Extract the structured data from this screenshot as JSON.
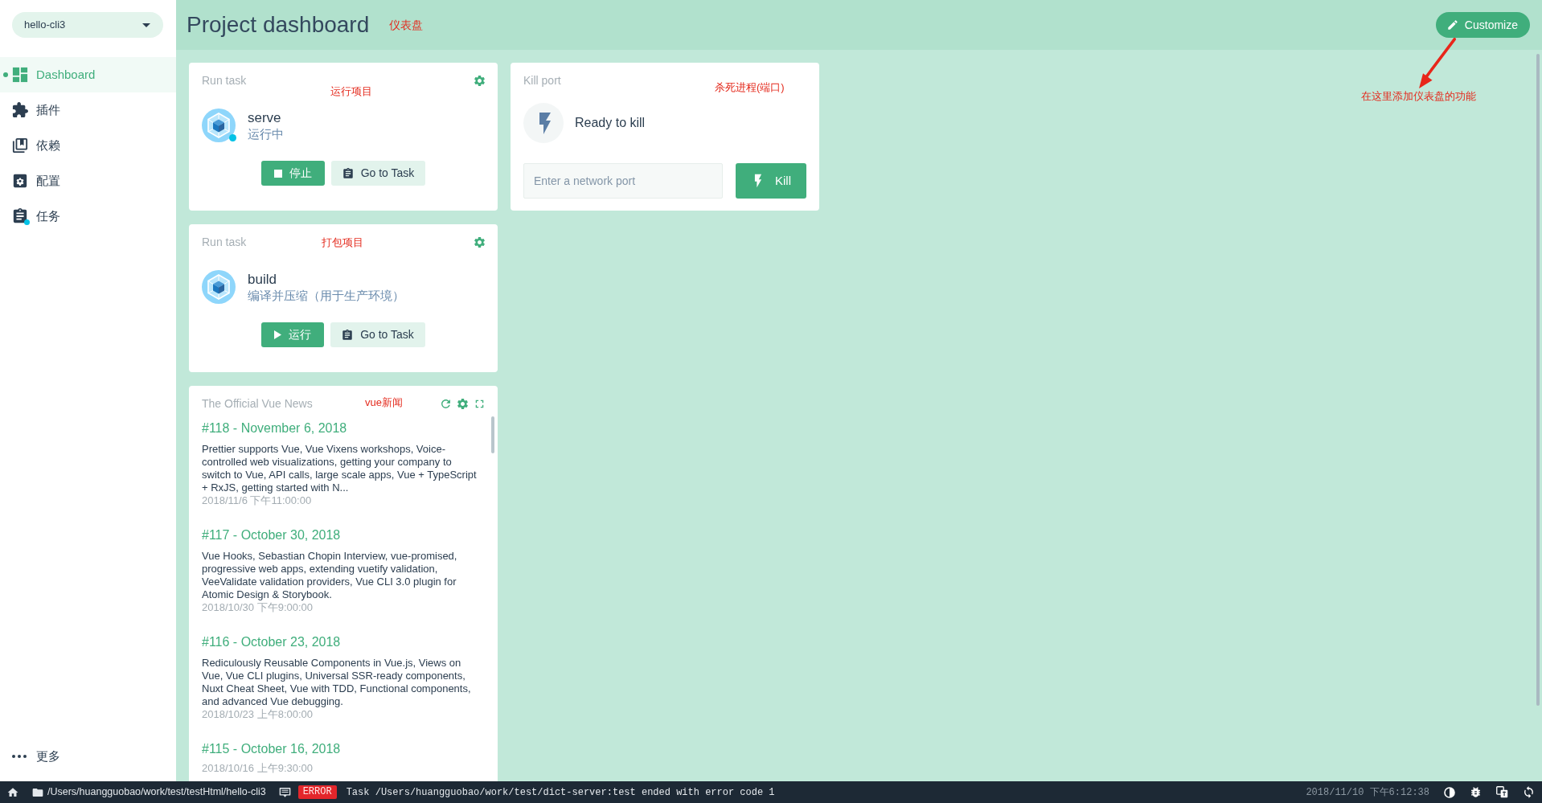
{
  "project": {
    "name": "hello-cli3"
  },
  "sidebar": {
    "items": [
      {
        "label": "Dashboard",
        "selected": true,
        "indicator": false
      },
      {
        "label": "插件",
        "selected": false,
        "indicator": false
      },
      {
        "label": "依赖",
        "selected": false,
        "indicator": false
      },
      {
        "label": "配置",
        "selected": false,
        "indicator": false
      },
      {
        "label": "任务",
        "selected": false,
        "indicator": true
      }
    ],
    "more": {
      "label": "更多"
    }
  },
  "header": {
    "title": "Project dashboard",
    "annotation": "仪表盘",
    "customize_button": {
      "label": "Customize"
    }
  },
  "callout": {
    "text": "在这里添加仪表盘的功能"
  },
  "columns": [
    {
      "widgets": [
        {
          "kind": "run_task",
          "title": "Run task",
          "annotation": "运行项目",
          "task": {
            "name": "serve",
            "description": "运行中",
            "running": true
          },
          "buttons": [
            {
              "kind": "stop",
              "label": "停止"
            },
            {
              "kind": "open",
              "label": "Go to Task"
            }
          ]
        },
        {
          "kind": "run_task",
          "title": "Run task",
          "annotation": "打包项目",
          "task": {
            "name": "build",
            "description": "编译并压缩（用于生产环境）",
            "running": false
          },
          "buttons": [
            {
              "kind": "run",
              "label": "运行"
            },
            {
              "kind": "open",
              "label": "Go to Task"
            }
          ]
        },
        {
          "kind": "news",
          "title": "The Official Vue News",
          "annotation": "vue新闻",
          "items": [
            {
              "title": "#118 - November 6, 2018",
              "summary": "Prettier supports Vue, Vue Vixens workshops, Voice-controlled web visualizations, getting your company to switch to Vue, API calls, large scale apps, Vue + TypeScript + RxJS, getting started with N...",
              "date": "2018/11/6 下午11:00:00"
            },
            {
              "title": "#117 - October 30, 2018",
              "summary": "Vue Hooks, Sebastian Chopin Interview, vue-promised, progressive web apps, extending vuetify validation, VeeValidate validation providers, Vue CLI 3.0 plugin for Atomic Design & Storybook.",
              "date": "2018/10/30 下午9:00:00"
            },
            {
              "title": "#116 - October 23, 2018",
              "summary": "Rediculously Reusable Components in Vue.js, Views on Vue, Vue CLI plugins, Universal SSR-ready components, Nuxt Cheat Sheet, Vue with TDD, Functional components, and advanced Vue debugging.",
              "date": "2018/10/23 上午8:00:00"
            },
            {
              "title": "#115 - October 16, 2018",
              "date": "2018/10/16 上午9:30:00"
            }
          ]
        }
      ]
    },
    {
      "widgets": [
        {
          "kind": "kill_port",
          "title": "Kill port",
          "annotation": "杀死进程(端口)",
          "status": "Ready to kill",
          "port_field": {
            "placeholder": "Enter a network port"
          },
          "button": {
            "label": "Kill"
          }
        }
      ]
    }
  ],
  "status_bar": {
    "path": "/Users/huangguobao/work/test/testHtml/hello-cli3",
    "log": {
      "kind": "error",
      "label": "ERROR",
      "message": "Task /Users/huangguobao/work/test/dict-server:test ended with error code 1"
    },
    "time": "2018/11/10 下午6:12:38"
  }
}
